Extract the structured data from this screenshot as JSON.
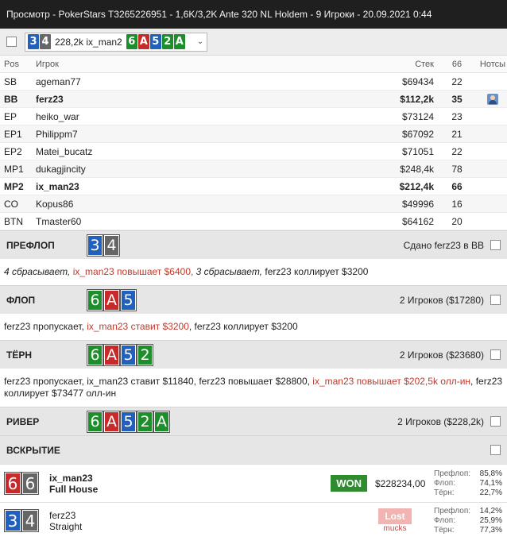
{
  "window": {
    "title": "Просмотр - PokerStars T3265226951 - 1,6K/3,2K Ante 320 NL Holdem - 9 Игроки - 20.09.2021 0:44"
  },
  "hand_selector": {
    "cards": [
      {
        "rank": "3",
        "color": "blue"
      },
      {
        "rank": "4",
        "color": "gray"
      }
    ],
    "label": "228,2k ix_man2",
    "board": [
      {
        "rank": "6",
        "color": "green"
      },
      {
        "rank": "A",
        "color": "red"
      },
      {
        "rank": "5",
        "color": "blue"
      },
      {
        "rank": "2",
        "color": "green"
      },
      {
        "rank": "A",
        "color": "green"
      }
    ],
    "chevron": "chevron-down-icon"
  },
  "players_table": {
    "headers": {
      "pos": "Pos",
      "name": "Игрок",
      "stack": "Стек",
      "vpip": "66",
      "notes": "Нотсы"
    },
    "rows": [
      {
        "pos": "SB",
        "name": "ageman77",
        "stack": "$69434",
        "vpip": "22",
        "bold": false,
        "note": false
      },
      {
        "pos": "BB",
        "name": "ferz23",
        "stack": "$112,2k",
        "vpip": "35",
        "bold": true,
        "note": true
      },
      {
        "pos": "EP",
        "name": "heiko_war",
        "stack": "$73124",
        "vpip": "23",
        "bold": false,
        "note": false
      },
      {
        "pos": "EP1",
        "name": "Philippm7",
        "stack": "$67092",
        "vpip": "21",
        "bold": false,
        "note": false
      },
      {
        "pos": "EP2",
        "name": "Matei_bucatz",
        "stack": "$71051",
        "vpip": "22",
        "bold": false,
        "note": false
      },
      {
        "pos": "MP1",
        "name": "dukagjincity",
        "stack": "$248,4k",
        "vpip": "78",
        "bold": false,
        "note": false
      },
      {
        "pos": "MP2",
        "name": "ix_man23",
        "stack": "$212,4k",
        "vpip": "66",
        "bold": true,
        "note": false
      },
      {
        "pos": "CO",
        "name": "Kopus86",
        "stack": "$49996",
        "vpip": "16",
        "bold": false,
        "note": false
      },
      {
        "pos": "BTN",
        "name": "Tmaster60",
        "stack": "$64162",
        "vpip": "20",
        "bold": false,
        "note": false
      }
    ]
  },
  "streets": {
    "preflop": {
      "name": "ПРЕФЛОП",
      "cards": [
        {
          "rank": "3",
          "color": "blue"
        },
        {
          "rank": "4",
          "color": "gray"
        }
      ],
      "info": "Сдано ferz23 в BB",
      "actions": [
        {
          "text": "4 сбрасывает, ",
          "style": "it"
        },
        {
          "text": "ix_man23 повышает $6400, ",
          "style": "red"
        },
        {
          "text": "3 сбрасывает, ",
          "style": "it"
        },
        {
          "text": "ferz23 коллирует $3200",
          "style": ""
        }
      ]
    },
    "flop": {
      "name": "ФЛОП",
      "cards": [
        {
          "rank": "6",
          "color": "green"
        },
        {
          "rank": "A",
          "color": "red"
        },
        {
          "rank": "5",
          "color": "blue"
        }
      ],
      "info": "2 Игроков ($17280)",
      "actions": [
        {
          "text": "ferz23 пропускает, ",
          "style": ""
        },
        {
          "text": "ix_man23 ставит $3200",
          "style": "red"
        },
        {
          "text": ", ferz23 коллирует $3200",
          "style": ""
        }
      ]
    },
    "turn": {
      "name": "ТЁРН",
      "cards": [
        {
          "rank": "6",
          "color": "green"
        },
        {
          "rank": "A",
          "color": "red"
        },
        {
          "rank": "5",
          "color": "blue"
        },
        {
          "rank": "2",
          "color": "green"
        }
      ],
      "info": "2 Игроков ($23680)",
      "actions": [
        {
          "text": "ferz23 пропускает, ix_man23 ставит $11840, ferz23 повышает $28800, ",
          "style": ""
        },
        {
          "text": "ix_man23 повышает $202,5k олл-ин",
          "style": "red"
        },
        {
          "text": ", ferz23 коллирует $73477 олл-ин",
          "style": ""
        }
      ]
    },
    "river": {
      "name": "РИВЕР",
      "cards": [
        {
          "rank": "6",
          "color": "green"
        },
        {
          "rank": "A",
          "color": "red"
        },
        {
          "rank": "5",
          "color": "blue"
        },
        {
          "rank": "2",
          "color": "green"
        },
        {
          "rank": "A",
          "color": "green"
        }
      ],
      "info": "2 Игроков ($228,2k)"
    },
    "showdown": {
      "name": "ВСКРЫТИЕ"
    }
  },
  "results": [
    {
      "cards": [
        {
          "rank": "6",
          "color": "red"
        },
        {
          "rank": "6",
          "color": "gray"
        }
      ],
      "player": "ix_man23",
      "hand": "Full House",
      "bold": true,
      "badge": "WON",
      "amount": "$228234,00",
      "equity": [
        {
          "label": "Префлоп:",
          "value": "85,8%"
        },
        {
          "label": "Флоп:",
          "value": "74,1%"
        },
        {
          "label": "Тёрн:",
          "value": "22,7%"
        }
      ]
    },
    {
      "cards": [
        {
          "rank": "3",
          "color": "blue"
        },
        {
          "rank": "4",
          "color": "gray"
        }
      ],
      "player": "ferz23",
      "hand": "Straight",
      "bold": false,
      "badge": "Lost",
      "sub": "mucks",
      "amount": "",
      "equity": [
        {
          "label": "Префлоп:",
          "value": "14,2%"
        },
        {
          "label": "Флоп:",
          "value": "25,9%"
        },
        {
          "label": "Тёрн:",
          "value": "77,3%"
        }
      ]
    }
  ]
}
